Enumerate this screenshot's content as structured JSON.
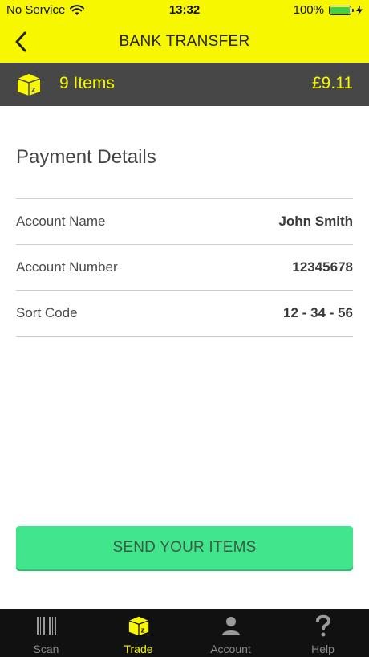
{
  "status_bar": {
    "carrier": "No Service",
    "time": "13:32",
    "battery": "100%"
  },
  "nav": {
    "title": "BANK TRANSFER",
    "back_icon": "chevron-left-icon"
  },
  "summary": {
    "items_label": "9 Items",
    "total": "£9.11",
    "icon": "box-icon"
  },
  "payment": {
    "title": "Payment Details",
    "rows": [
      {
        "label": "Account Name",
        "value": "John Smith"
      },
      {
        "label": "Account Number",
        "value": "12345678"
      },
      {
        "label": "Sort Code",
        "value": "12 - 34 - 56"
      }
    ]
  },
  "actions": {
    "send_label": "SEND YOUR ITEMS"
  },
  "tabs": [
    {
      "label": "Scan",
      "icon": "barcode-icon",
      "active": false
    },
    {
      "label": "Trade",
      "icon": "box-icon",
      "active": true
    },
    {
      "label": "Account",
      "icon": "person-icon",
      "active": false
    },
    {
      "label": "Help",
      "icon": "question-icon",
      "active": false
    }
  ],
  "colors": {
    "brand_yellow": "#f7f700",
    "dark_bar": "#474747",
    "button_green": "#41e58b",
    "tab_bar": "#111111"
  }
}
